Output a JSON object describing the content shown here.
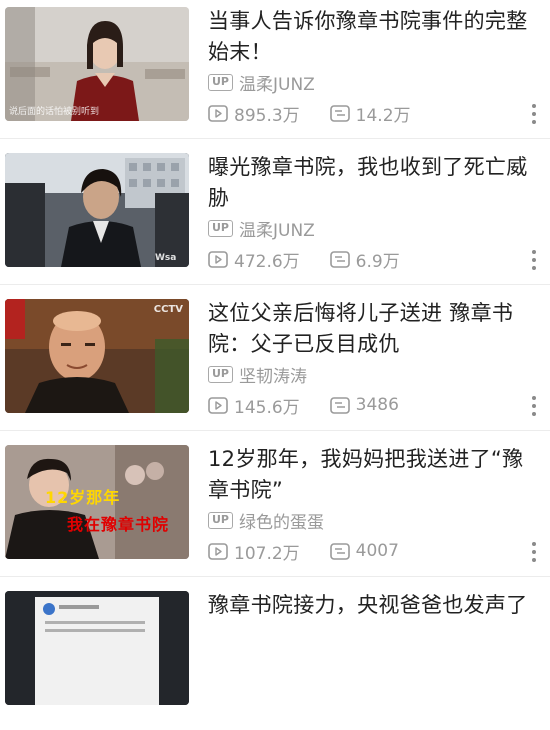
{
  "colors": {
    "meta_text": "#9a9a9a",
    "title_text": "#222222",
    "divider": "#ececec",
    "overlay_yellow": "#ffd700",
    "overlay_red": "#e00000"
  },
  "videos": [
    {
      "title": "当事人告诉你豫章书院事件的完整始末！",
      "up_badge": "UP",
      "uploader": "温柔JUNZ",
      "views": "895.3万",
      "danmaku": "14.2万",
      "thumb_caption": "说后面的话怕被别听到"
    },
    {
      "title": "曝光豫章书院，我也收到了死亡威胁",
      "up_badge": "UP",
      "uploader": "温柔JUNZ",
      "views": "472.6万",
      "danmaku": "6.9万",
      "thumb_caption": "Wsa"
    },
    {
      "title": "这位父亲后悔将儿子送进  豫章书院：父子已反目成仇",
      "up_badge": "UP",
      "uploader": "坚韧涛涛",
      "views": "145.6万",
      "danmaku": "3486",
      "thumb_caption": "CCTV"
    },
    {
      "title": "12岁那年，我妈妈把我送进了“豫章书院”",
      "up_badge": "UP",
      "uploader": "绿色的蛋蛋",
      "views": "107.2万",
      "danmaku": "4007",
      "thumb_caption_line1": "12岁那年",
      "thumb_caption_line2": "我在豫章书院"
    },
    {
      "title": "豫章书院接力，央视爸爸也发声了"
    }
  ]
}
